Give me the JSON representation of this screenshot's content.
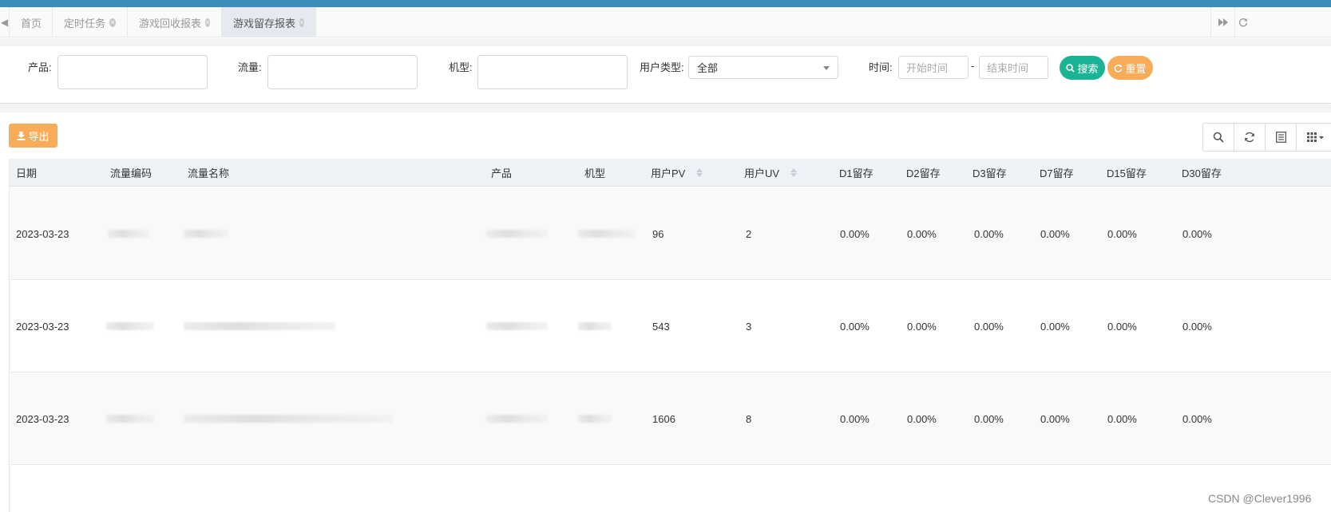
{
  "tabs": [
    {
      "label": "首页",
      "closable": false,
      "active": false
    },
    {
      "label": "定时任务",
      "closable": true,
      "active": false
    },
    {
      "label": "游戏回收报表",
      "closable": true,
      "active": false
    },
    {
      "label": "游戏留存报表",
      "closable": true,
      "active": true
    }
  ],
  "filters": {
    "product_label": "产品:",
    "traffic_label": "流量:",
    "model_label": "机型:",
    "user_type_label": "用户类型:",
    "user_type_value": "全部",
    "time_label": "时间:",
    "start_placeholder": "开始时间",
    "separator": "-",
    "end_placeholder": "结束时间",
    "search_label": "搜索",
    "reset_label": "重置"
  },
  "toolbar": {
    "export_label": "导出"
  },
  "table": {
    "columns": [
      "日期",
      "流量编码",
      "流量名称",
      "产品",
      "机型",
      "用户PV",
      "用户UV",
      "D1留存",
      "D2留存",
      "D3留存",
      "D7留存",
      "D15留存",
      "D30留存"
    ],
    "sortable_columns": [
      "用户PV",
      "用户UV"
    ],
    "rows": [
      {
        "date": "2023-03-23",
        "pv": "96",
        "uv": "2",
        "d1": "0.00%",
        "d2": "0.00%",
        "d3": "0.00%",
        "d7": "0.00%",
        "d15": "0.00%",
        "d30": "0.00%"
      },
      {
        "date": "2023-03-23",
        "pv": "543",
        "uv": "3",
        "d1": "0.00%",
        "d2": "0.00%",
        "d3": "0.00%",
        "d7": "0.00%",
        "d15": "0.00%",
        "d30": "0.00%"
      },
      {
        "date": "2023-03-23",
        "pv": "1606",
        "uv": "8",
        "d1": "0.00%",
        "d2": "0.00%",
        "d3": "0.00%",
        "d7": "0.00%",
        "d15": "0.00%",
        "d30": "0.00%"
      }
    ]
  },
  "watermark": "CSDN @Clever1996",
  "colors": {
    "topbar": "#3c8dbc",
    "search_button": "#1ab394",
    "reset_button": "#f8ac59",
    "export_button": "#f8ac59",
    "table_header": "#eff3f8"
  },
  "icons": {
    "tab_left": "caret-left-icon",
    "tab_close": "close-circle-icon",
    "tab_forward": "forward-icon",
    "tab_refresh": "refresh-icon",
    "search": "search-icon",
    "reset": "refresh-icon",
    "export": "download-icon",
    "tool_search": "search-icon",
    "tool_refresh": "refresh-icon",
    "tool_toggle": "list-icon",
    "tool_columns": "grid-icon"
  }
}
